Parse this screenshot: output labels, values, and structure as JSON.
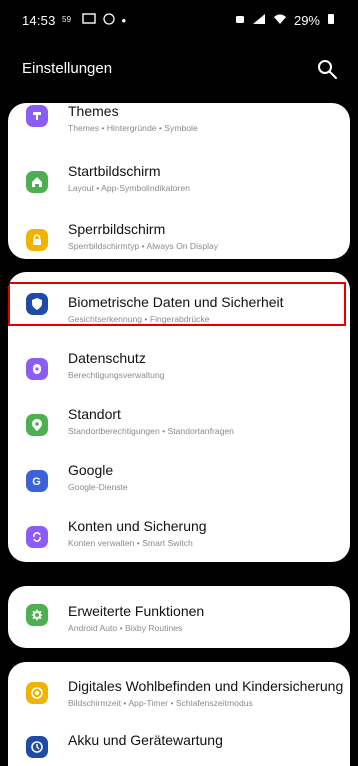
{
  "status_bar": {
    "time": "14:53",
    "icons_left": [
      "data-speed-icon",
      "screen-icon",
      "notification-icon",
      "dot-icon"
    ],
    "battery": "29%"
  },
  "header": {
    "title": "Einstellungen"
  },
  "sections": [
    {
      "items": [
        {
          "title": "Themes",
          "subtitle": "Themes • Hintergründe • Symbole",
          "icon": "themes-icon",
          "color": "#8b5cf6"
        },
        {
          "title": "Startbildschirm",
          "subtitle": "Layout • App-Symbolindikatoren",
          "icon": "home-icon",
          "color": "#4caf50"
        },
        {
          "title": "Sperrbildschirm",
          "subtitle": "Sperrbildschirmtyp • Always On Display",
          "icon": "lock-icon",
          "color": "#f0b400"
        }
      ]
    },
    {
      "items": [
        {
          "title": "Biometrische Daten und Sicherheit",
          "subtitle": "Gesichtserkennung • Fingerabdrücke",
          "icon": "shield-icon",
          "color": "#1f4aa8"
        },
        {
          "title": "Datenschutz",
          "subtitle": "Berechtigungsverwaltung",
          "icon": "privacy-icon",
          "color": "#8b5cf6"
        },
        {
          "title": "Standort",
          "subtitle": "Standortberechtigungen • Standortanfragen",
          "icon": "location-icon",
          "color": "#4caf50"
        },
        {
          "title": "Google",
          "subtitle": "Google-Dienste",
          "icon": "google-icon",
          "color": "#3b62d6"
        },
        {
          "title": "Konten und Sicherung",
          "subtitle": "Konten verwalten • Smart Switch",
          "icon": "accounts-icon",
          "color": "#8b5cf6"
        }
      ]
    },
    {
      "items": [
        {
          "title": "Erweiterte Funktionen",
          "subtitle": "Android Auto • Bixby Routines",
          "icon": "advanced-icon",
          "color": "#4caf50"
        }
      ]
    },
    {
      "items": [
        {
          "title": "Digitales Wohlbefinden und Kindersicherung",
          "subtitle": "Bildschirmzeit • App-Timer • Schlafenszeitmodus",
          "icon": "wellbeing-icon",
          "color": "#f0b400"
        },
        {
          "title": "Akku und Gerätewartung",
          "subtitle": "",
          "icon": "battery-care-icon",
          "color": "#1f4aa8"
        }
      ]
    }
  ]
}
